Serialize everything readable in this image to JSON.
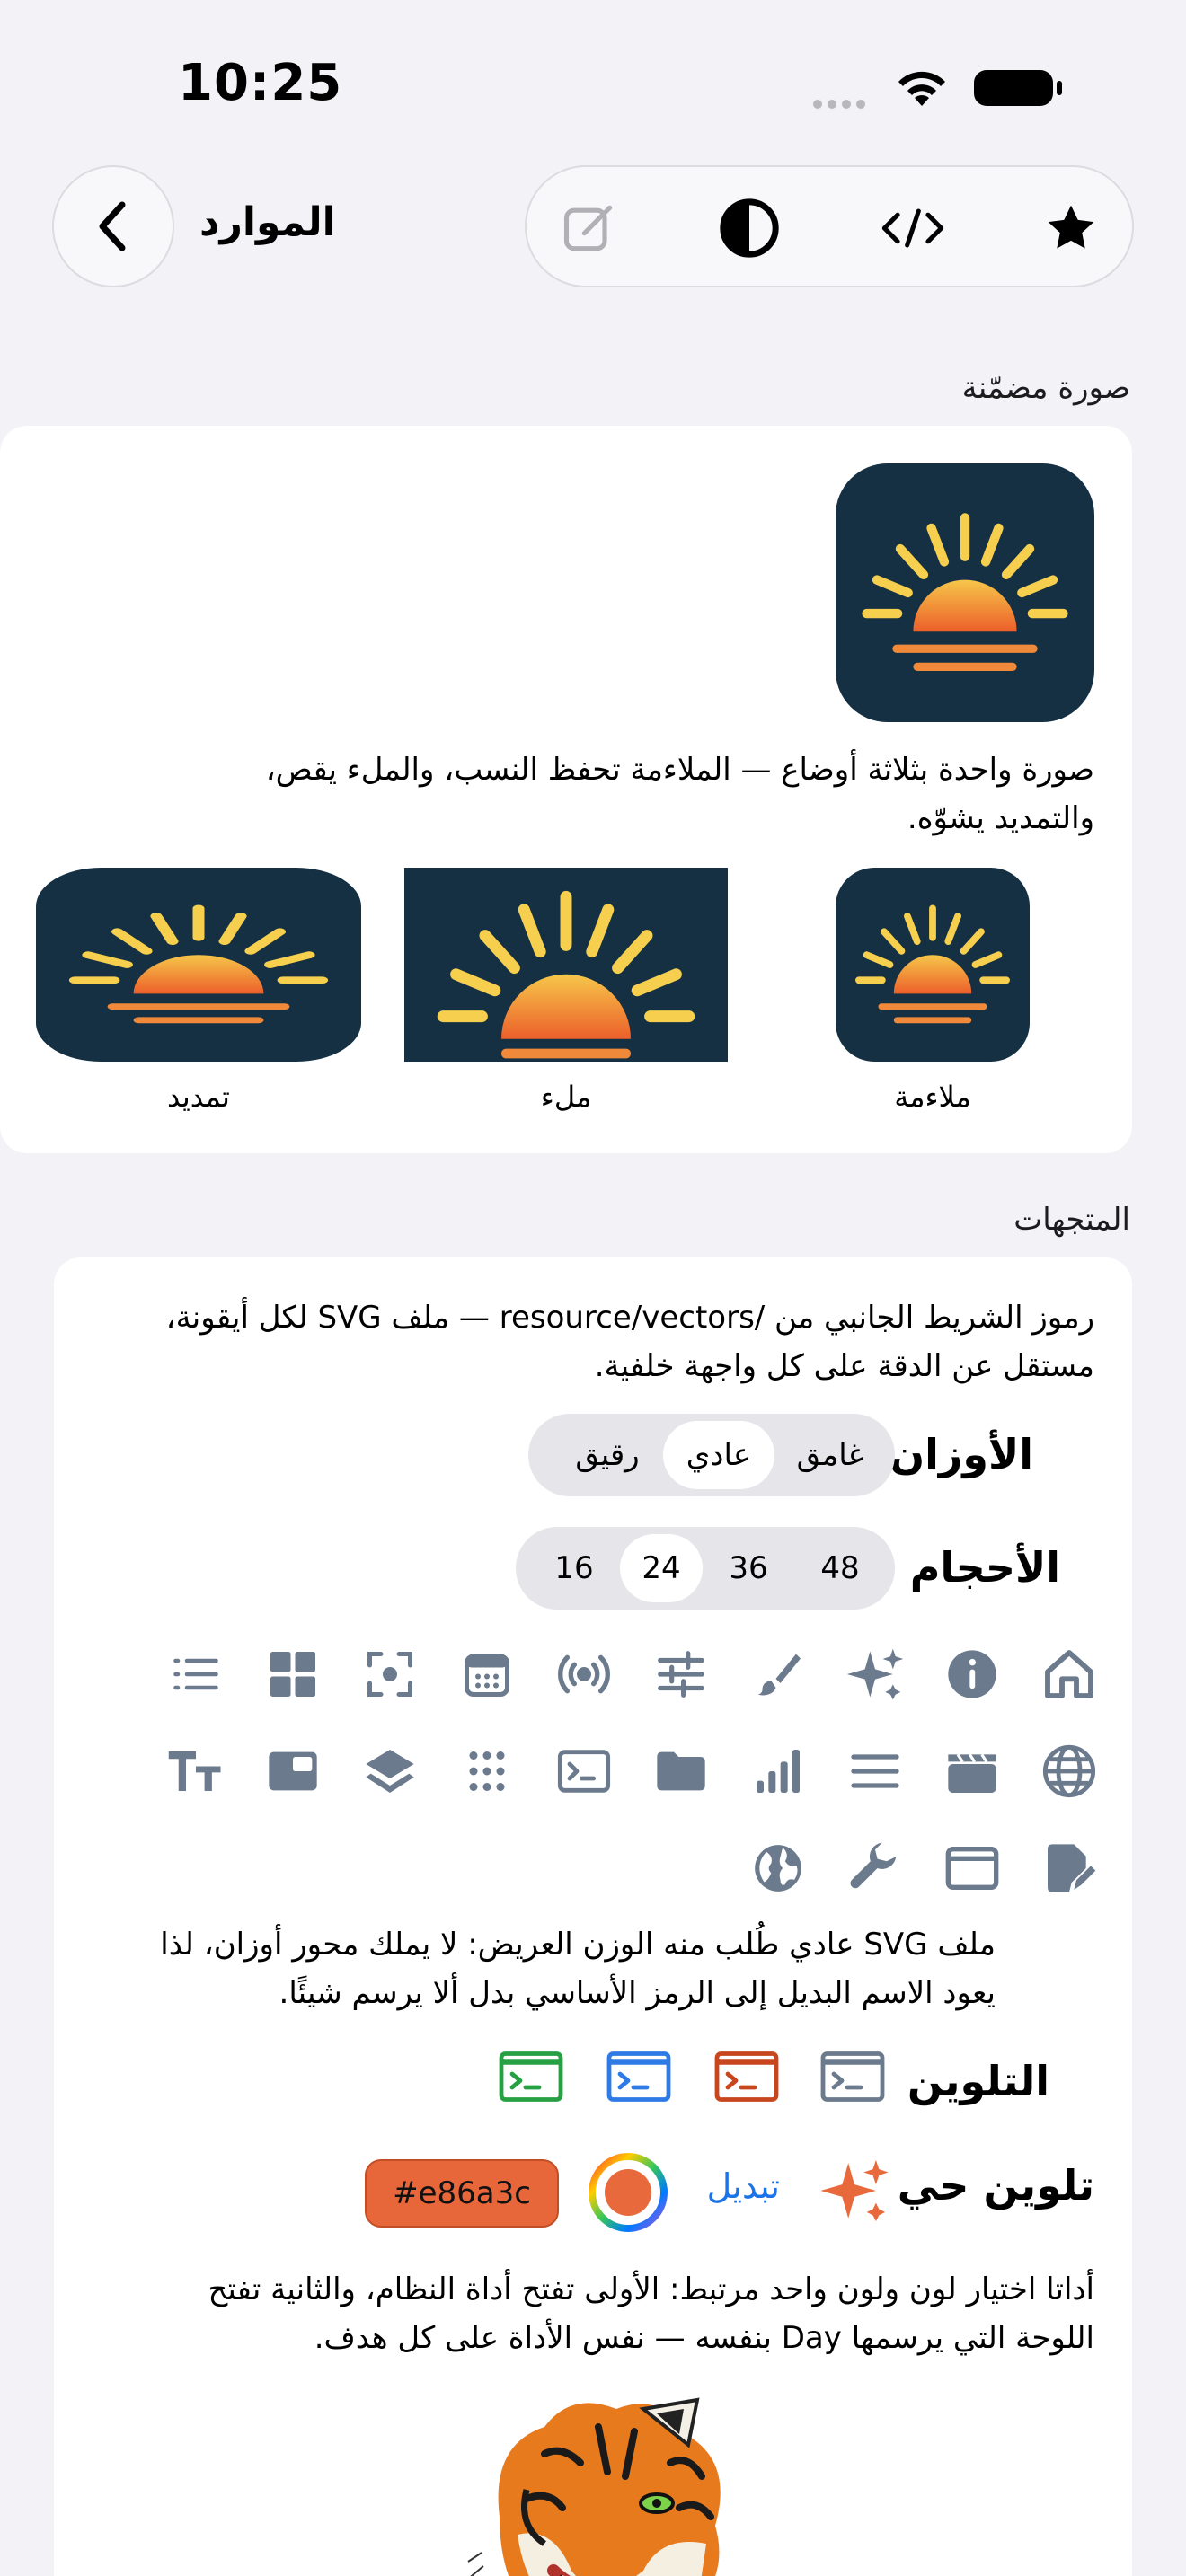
{
  "status_bar": {
    "time": "10:25"
  },
  "nav": {
    "title": "الموارد"
  },
  "sections": {
    "embedded_image": {
      "label": "صورة مضمّنة",
      "description": "صورة واحدة بثلاثة أوضاع — الملاءمة تحفظ النسب، والملء يقص، والتمديد يشوّه.",
      "modes": [
        "ملاءمة",
        "ملء",
        "تمديد"
      ]
    },
    "vectors": {
      "label": "المتجهات",
      "description": "رموز الشريط الجانبي من /resource/vectors — ملف SVG لكل أيقونة، مستقل عن الدقة على كل واجهة خلفية.",
      "weights": {
        "label": "الأوزان",
        "options": [
          "غامق",
          "عادي",
          "رقيق"
        ],
        "selected": "عادي"
      },
      "sizes": {
        "label": "الأحجام",
        "options": [
          "48",
          "36",
          "24",
          "16"
        ],
        "selected": "24"
      },
      "icon_rows": [
        [
          "home-icon",
          "info-icon",
          "sparkles-icon",
          "paintbrush-icon",
          "sliders-icon",
          "broadcast-icon",
          "calendar-icon",
          "viewfinder-icon",
          "grid-icon",
          "list-icon"
        ],
        [
          "globe-icon",
          "clapperboard-icon",
          "lines-icon",
          "bar-chart-icon",
          "folder-icon",
          "terminal-icon",
          "dots-grid-icon",
          "layers-icon",
          "window-icon",
          "text-size-icon"
        ],
        [
          "doc-edit-icon",
          "browser-window-icon",
          "wrench-icon",
          "globe-filled-icon"
        ]
      ],
      "fallback_note": "ملف SVG عادي طُلب منه الوزن العريض: لا يملك محور أوزان، لذا يعود الاسم البديل إلى الرمز الأساسي بدل ألا يرسم شيئًا.",
      "tinting": {
        "label": "التلوين",
        "colors": [
          "#6b7a8c",
          "#c8461e",
          "#2f7be5",
          "#27a043"
        ]
      },
      "live_tint": {
        "label": "تلوين حي",
        "toggle_label": "تبديل",
        "hex": "#e86a3c",
        "color": "#e86a3c"
      },
      "picker_note": "أداتا اختيار لون ولون واحد مرتبط: الأولى تفتح أداة النظام، والثانية تفتح اللوحة التي يرسمها Day بنفسه — نفس الأداة على كل هدف."
    }
  }
}
